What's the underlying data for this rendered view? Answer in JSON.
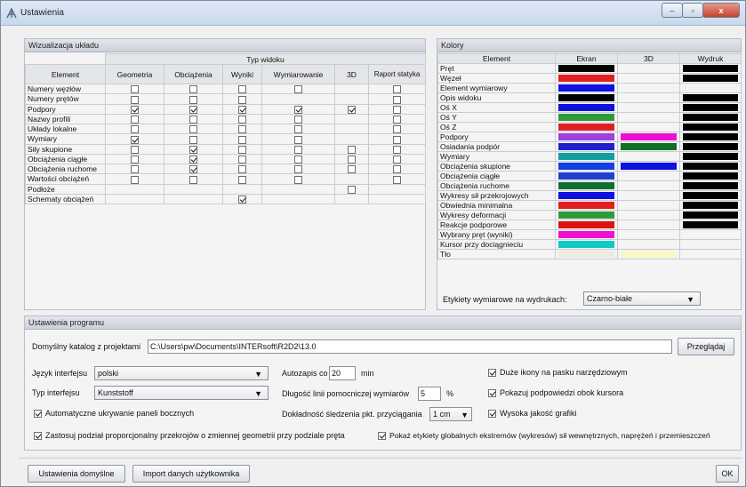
{
  "window": {
    "title": "Ustawienia",
    "min": "–",
    "max": "▫",
    "close": "x",
    "icon": "app-icon"
  },
  "viz": {
    "title": "Wizualizacja układu",
    "group_header": "Typ widoku",
    "columns": [
      "Element",
      "Geometria",
      "Obciążenia",
      "Wyniki",
      "Wymiarowanie",
      "3D",
      "Raport statyka"
    ],
    "rows": [
      {
        "name": "Numery węzłów",
        "cells": [
          "u",
          "u",
          "u",
          "u",
          "n",
          "u"
        ]
      },
      {
        "name": "Numery prętów",
        "cells": [
          "u",
          "u",
          "u",
          "n",
          "n",
          "u"
        ]
      },
      {
        "name": "Podpory",
        "cells": [
          "c",
          "c",
          "c",
          "c",
          "c",
          "u"
        ]
      },
      {
        "name": "Nazwy profili",
        "cells": [
          "u",
          "u",
          "u",
          "u",
          "n",
          "u"
        ]
      },
      {
        "name": "Układy lokalne",
        "cells": [
          "u",
          "u",
          "u",
          "u",
          "n",
          "u"
        ]
      },
      {
        "name": "Wymiary",
        "cells": [
          "c",
          "u",
          "u",
          "u",
          "n",
          "u"
        ]
      },
      {
        "name": "Siły skupione",
        "cells": [
          "u",
          "c",
          "u",
          "u",
          "u",
          "u"
        ]
      },
      {
        "name": "Obciążenia ciągłe",
        "cells": [
          "u",
          "c",
          "u",
          "u",
          "u",
          "u"
        ]
      },
      {
        "name": "Obciążenia ruchome",
        "cells": [
          "u",
          "c",
          "u",
          "u",
          "u",
          "u"
        ]
      },
      {
        "name": "Wartości obciążeń",
        "cells": [
          "u",
          "u",
          "u",
          "u",
          "n",
          "u"
        ]
      },
      {
        "name": "Podłoże",
        "cells": [
          "n",
          "n",
          "n",
          "n",
          "u",
          "n"
        ]
      },
      {
        "name": "Schematy obciążeń",
        "cells": [
          "n",
          "n",
          "c",
          "n",
          "n",
          "n"
        ]
      }
    ]
  },
  "colors": {
    "title": "Kolory",
    "columns": [
      "Element",
      "Ekran",
      "3D",
      "Wydruk"
    ],
    "rows": [
      {
        "name": "Pręt",
        "ekran": "#000000",
        "d3": "",
        "wydruk": "#000000"
      },
      {
        "name": "Węzeł",
        "ekran": "#e02020",
        "d3": "",
        "wydruk": "#000000"
      },
      {
        "name": "Element wymiarowy",
        "ekran": "#1010e0",
        "d3": "",
        "wydruk": ""
      },
      {
        "name": "Opis widoku",
        "ekran": "#000000",
        "d3": "",
        "wydruk": "#000000"
      },
      {
        "name": "Oś X",
        "ekran": "#1010e0",
        "d3": "",
        "wydruk": "#000000"
      },
      {
        "name": "Oś Y",
        "ekran": "#2e9a3a",
        "d3": "",
        "wydruk": "#000000"
      },
      {
        "name": "Oś Z",
        "ekran": "#e02020",
        "d3": "",
        "wydruk": "#000000"
      },
      {
        "name": "Podpory",
        "ekran": "#a040e0",
        "d3": "#ee10d0",
        "wydruk": "#000000"
      },
      {
        "name": "Osiadania podpór",
        "ekran": "#2020d0",
        "d3": "#107020",
        "wydruk": "#000000"
      },
      {
        "name": "Wymiary",
        "ekran": "#10a0a0",
        "d3": "",
        "wydruk": "#000000"
      },
      {
        "name": "Obciążenia skupione",
        "ekran": "#1040e0",
        "d3": "#1010e0",
        "wydruk": "#000000"
      },
      {
        "name": "Obciążenia ciągłe",
        "ekran": "#2040d0",
        "d3": "",
        "wydruk": "#000000"
      },
      {
        "name": "Obciążenia ruchome",
        "ekran": "#107030",
        "d3": "",
        "wydruk": "#000000"
      },
      {
        "name": "Wykresy sił przekrojowych",
        "ekran": "#1010e0",
        "d3": "",
        "wydruk": "#000000"
      },
      {
        "name": "Obwiednia minimalna",
        "ekran": "#e02020",
        "d3": "",
        "wydruk": "#000000"
      },
      {
        "name": "Wykresy deformacji",
        "ekran": "#2e9a3a",
        "d3": "",
        "wydruk": "#000000"
      },
      {
        "name": "Reakcje podporowe",
        "ekran": "#e01010",
        "d3": "",
        "wydruk": "#000000"
      },
      {
        "name": "Wybrany pręt (wyniki)",
        "ekran": "#ee10d0",
        "d3": "",
        "wydruk": ""
      },
      {
        "name": "Kursor przy dociągnieciu",
        "ekran": "#10c8c8",
        "d3": "",
        "wydruk": ""
      },
      {
        "name": "Tło",
        "ekran": "#ebebde",
        "d3": "#f8f8c8",
        "wydruk": ""
      }
    ],
    "print_labels_label": "Etykiety wymiarowe na wydrukach:",
    "print_labels_value": "Czarno-białe"
  },
  "program": {
    "title": "Ustawienia programu",
    "dir_label": "Domyślny katalog z projektami",
    "dir_value": "C:\\Users\\pw\\Documents\\INTERsoft\\R2D2\\13.0",
    "browse": "Przeglądaj",
    "lang_label": "Język interfejsu",
    "lang_value": "polski",
    "type_label": "Typ interfejsu",
    "type_value": "Kunststoff",
    "autohide": "Automatyczne ukrywanie paneli bocznych",
    "autosave_label": "Autozapis co",
    "autosave_value": "20",
    "autosave_unit": "min",
    "helper_label": "Długość linii pomocniczej wymiarów",
    "helper_value": "5",
    "helper_unit": "%",
    "snap_label": "Dokładność śledzenia pkt. przyciągania",
    "snap_value": "1 cm",
    "big_icons": "Duże ikony na pasku narzędziowym",
    "tips": "Pokazuj podpowiedzi obok kursora",
    "quality": "Wysoka jakość grafiki",
    "proportional": "Zastosuj podział proporcjonalny przekrojów o zmiennej geometrii przy podziale pręta",
    "global_labels": "Pokaż etykiety globalnych ekstremów (wykresów) sił wewnętrznych, naprężeń i przemieszczeń"
  },
  "footer": {
    "defaults": "Ustawienia domyślne",
    "import": "Import danych użytkownika",
    "ok": "OK"
  }
}
